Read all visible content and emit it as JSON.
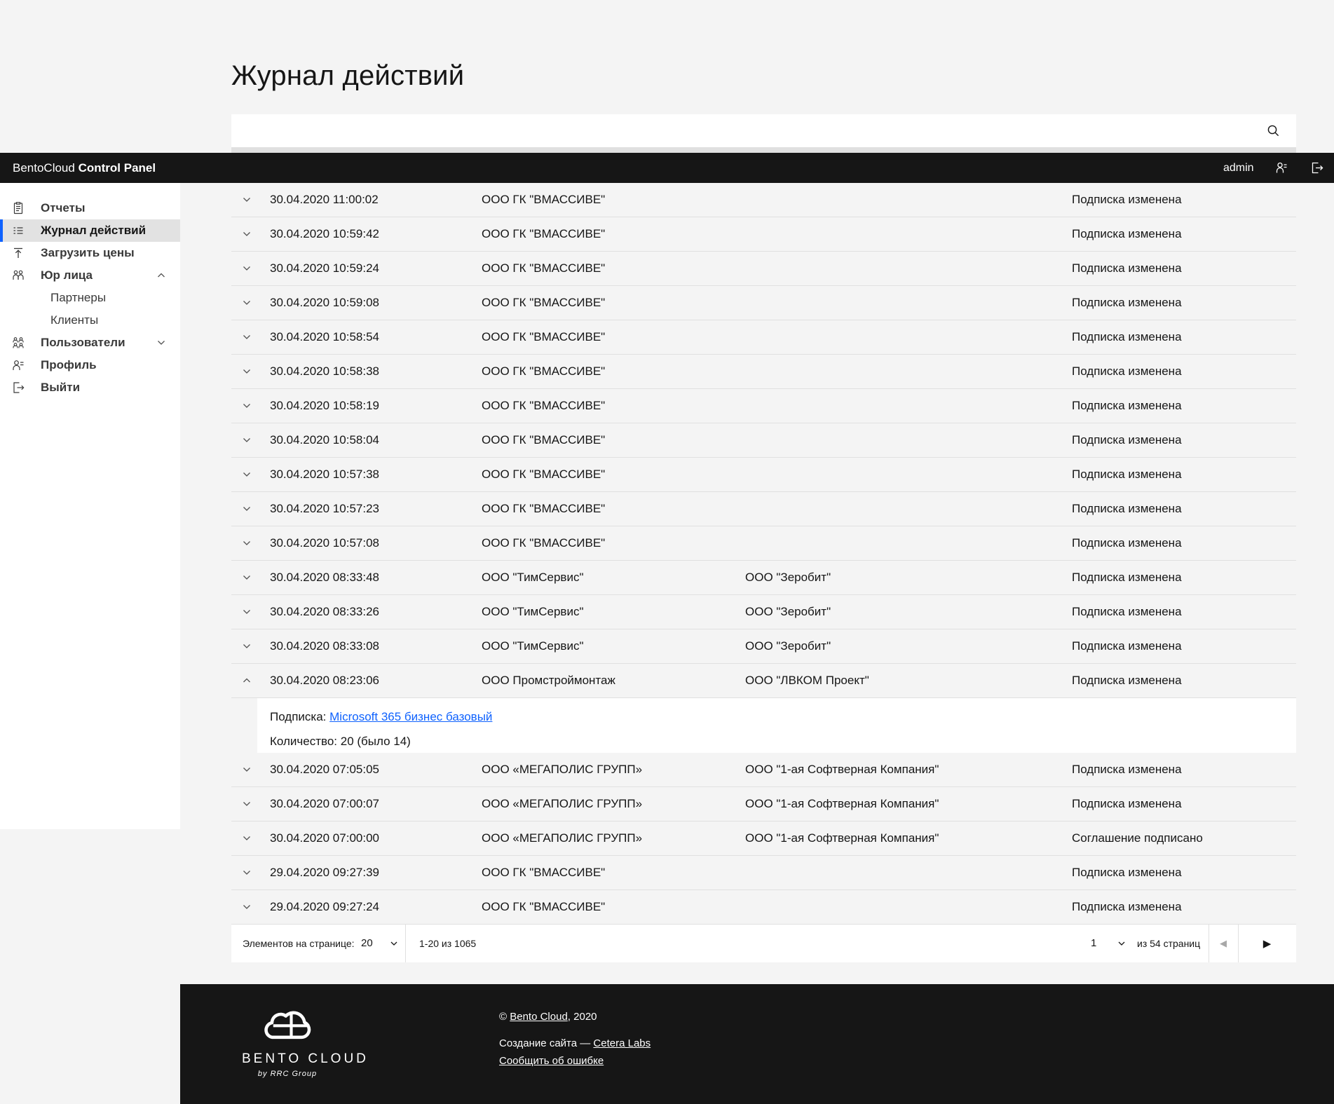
{
  "colors": {
    "page_bg": "#f4f4f4",
    "bar_bg": "#161616",
    "accent_blue": "#0f62fe",
    "link_blue": "#0f62fe",
    "border": "#e0e0e0",
    "text": "#161616",
    "footer_bg": "#161616"
  },
  "page": {
    "title": "Журнал действий"
  },
  "search": {
    "value": "",
    "placeholder": "",
    "icon": "search-icon"
  },
  "topbar": {
    "brand_regular": "BentoCloud",
    "brand_bold": "Control Panel",
    "user": "admin",
    "icons": [
      "user-profile-icon",
      "logout-icon"
    ]
  },
  "sidebar": {
    "items": [
      {
        "label": "Отчеты",
        "icon": "report-icon",
        "active": false
      },
      {
        "label": "Журнал действий",
        "icon": "journal-icon",
        "active": true
      },
      {
        "label": "Загрузить цены",
        "icon": "upload-icon",
        "active": false
      },
      {
        "label": "Юр лица",
        "icon": "partnership-icon",
        "active": false,
        "chevron": "up",
        "children": [
          "Партнеры",
          "Клиенты"
        ]
      },
      {
        "label": "Пользователи",
        "icon": "users-icon",
        "active": false,
        "chevron": "down"
      },
      {
        "label": "Профиль",
        "icon": "user-profile-icon",
        "active": false
      },
      {
        "label": "Выйти",
        "icon": "logout-icon",
        "active": false
      }
    ]
  },
  "table": {
    "rows": [
      {
        "time": "30.04.2020 11:00:02",
        "partner": "ООО ГК \"ВМАССИВЕ\"",
        "client": "",
        "action": "Подписка изменена",
        "expanded": false
      },
      {
        "time": "30.04.2020 10:59:42",
        "partner": "ООО ГК \"ВМАССИВЕ\"",
        "client": "",
        "action": "Подписка изменена",
        "expanded": false
      },
      {
        "time": "30.04.2020 10:59:24",
        "partner": "ООО ГК \"ВМАССИВЕ\"",
        "client": "",
        "action": "Подписка изменена",
        "expanded": false
      },
      {
        "time": "30.04.2020 10:59:08",
        "partner": "ООО ГК \"ВМАССИВЕ\"",
        "client": "",
        "action": "Подписка изменена",
        "expanded": false
      },
      {
        "time": "30.04.2020 10:58:54",
        "partner": "ООО ГК \"ВМАССИВЕ\"",
        "client": "",
        "action": "Подписка изменена",
        "expanded": false
      },
      {
        "time": "30.04.2020 10:58:38",
        "partner": "ООО ГК \"ВМАССИВЕ\"",
        "client": "",
        "action": "Подписка изменена",
        "expanded": false
      },
      {
        "time": "30.04.2020 10:58:19",
        "partner": "ООО ГК \"ВМАССИВЕ\"",
        "client": "",
        "action": "Подписка изменена",
        "expanded": false
      },
      {
        "time": "30.04.2020 10:58:04",
        "partner": "ООО ГК \"ВМАССИВЕ\"",
        "client": "",
        "action": "Подписка изменена",
        "expanded": false
      },
      {
        "time": "30.04.2020 10:57:38",
        "partner": "ООО ГК \"ВМАССИВЕ\"",
        "client": "",
        "action": "Подписка изменена",
        "expanded": false
      },
      {
        "time": "30.04.2020 10:57:23",
        "partner": "ООО ГК \"ВМАССИВЕ\"",
        "client": "",
        "action": "Подписка изменена",
        "expanded": false
      },
      {
        "time": "30.04.2020 10:57:08",
        "partner": "ООО ГК \"ВМАССИВЕ\"",
        "client": "",
        "action": "Подписка изменена",
        "expanded": false
      },
      {
        "time": "30.04.2020 08:33:48",
        "partner": "ООО \"ТимСервис\"",
        "client": "ООО \"Зеробит\"",
        "action": "Подписка изменена",
        "expanded": false
      },
      {
        "time": "30.04.2020 08:33:26",
        "partner": "ООО \"ТимСервис\"",
        "client": "ООО \"Зеробит\"",
        "action": "Подписка изменена",
        "expanded": false
      },
      {
        "time": "30.04.2020 08:33:08",
        "partner": "ООО \"ТимСервис\"",
        "client": "ООО \"Зеробит\"",
        "action": "Подписка изменена",
        "expanded": false
      },
      {
        "time": "30.04.2020 08:23:06",
        "partner": "ООО Промстроймонтаж",
        "client": "ООО \"ЛВКОМ Проект\"",
        "action": "Подписка изменена",
        "expanded": true
      },
      {
        "time": "30.04.2020 07:05:05",
        "partner": "ООО «МЕГАПОЛИС ГРУПП»",
        "client": "ООО \"1-ая Софтверная Компания\"",
        "action": "Подписка изменена",
        "expanded": false
      },
      {
        "time": "30.04.2020 07:00:07",
        "partner": "ООО «МЕГАПОЛИС ГРУПП»",
        "client": "ООО \"1-ая Софтверная Компания\"",
        "action": "Подписка изменена",
        "expanded": false
      },
      {
        "time": "30.04.2020 07:00:00",
        "partner": "ООО «МЕГАПОЛИС ГРУПП»",
        "client": "ООО \"1-ая Софтверная Компания\"",
        "action": "Соглашение подписано",
        "expanded": false
      },
      {
        "time": "29.04.2020 09:27:39",
        "partner": "ООО ГК \"ВМАССИВЕ\"",
        "client": "",
        "action": "Подписка изменена",
        "expanded": false
      },
      {
        "time": "29.04.2020 09:27:24",
        "partner": "ООО ГК \"ВМАССИВЕ\"",
        "client": "",
        "action": "Подписка изменена",
        "expanded": false
      }
    ],
    "expanded_detail": {
      "subscription_label": "Подписка: ",
      "subscription_link": "Microsoft 365 бизнес базовый",
      "quantity_line": "Количество: 20 (было 14)"
    }
  },
  "pagination": {
    "items_per_page_label": "Элементов на странице:",
    "page_size": "20",
    "range_text": "1-20 из 1065",
    "current_page": "1",
    "pages_text": "из 54 страниц",
    "prev_icon": "chevron-left-icon",
    "next_icon": "chevron-right-icon"
  },
  "footer": {
    "logo_icon": "bento-cloud-logo",
    "logo_title": "BENTO CLOUD",
    "logo_subtitle": "by RRC Group",
    "copyright_prefix": "© ",
    "copyright_link": "Bento Cloud",
    "copyright_suffix": ", 2020",
    "site_by_prefix": "Создание сайта — ",
    "site_by_link": "Cetera Labs",
    "report_error_link": "Сообщить об ошибке"
  }
}
